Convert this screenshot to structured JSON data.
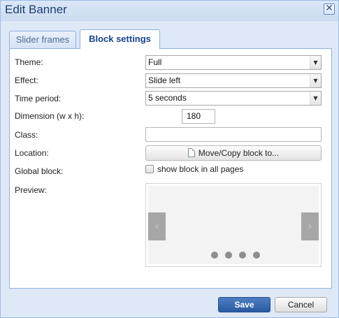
{
  "dialog": {
    "title": "Edit Banner",
    "close_symbol": "✕"
  },
  "tabs": [
    {
      "label": "Slider frames",
      "active": false
    },
    {
      "label": "Block settings",
      "active": true
    }
  ],
  "form": {
    "theme": {
      "label": "Theme:",
      "value": "Full"
    },
    "effect": {
      "label": "Effect:",
      "value": "Slide left"
    },
    "time_period": {
      "label": "Time period:",
      "value": "5 seconds"
    },
    "dimension": {
      "label": "Dimension (w x h):",
      "value": "180"
    },
    "class": {
      "label": "Class:",
      "value": ""
    },
    "location": {
      "label": "Location:",
      "button_label": "Move/Copy block to..."
    },
    "global_block": {
      "label": "Global block:",
      "checkbox_label": "show block in all pages",
      "checked": false
    },
    "preview": {
      "label": "Preview:",
      "prev_symbol": "‹",
      "next_symbol": "›",
      "dot_count": 4
    }
  },
  "footer": {
    "save_label": "Save",
    "cancel_label": "Cancel"
  },
  "colors": {
    "dialog_background": "#dfe8f6",
    "title_text": "#1c3f73",
    "active_tab_text": "#15428b",
    "save_button": "#2a5aa3"
  },
  "icons": {
    "close": "close-icon",
    "select_arrow": "chevron-down-icon",
    "location_button": "document-icon",
    "preview_prev": "chevron-left-icon",
    "preview_next": "chevron-right-icon"
  }
}
